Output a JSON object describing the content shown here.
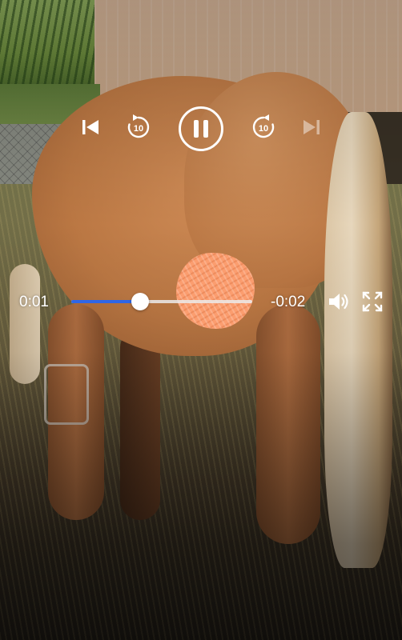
{
  "player": {
    "state": "playing",
    "time_elapsed": "0:01",
    "time_remaining": "-0:02",
    "progress_fraction": 0.38,
    "accent_color": "#2f66e6",
    "controls": {
      "previous": {
        "icon": "skip-previous-icon",
        "enabled": true
      },
      "rewind": {
        "icon": "rewind-10-icon",
        "seconds": "10",
        "enabled": true
      },
      "pause": {
        "icon": "pause-icon",
        "enabled": true
      },
      "forward": {
        "icon": "forward-10-icon",
        "seconds": "10",
        "enabled": true
      },
      "next": {
        "icon": "skip-next-icon",
        "enabled": false
      },
      "volume": {
        "icon": "volume-icon",
        "enabled": true
      },
      "fullscreen": {
        "icon": "fullscreen-icon",
        "enabled": true
      }
    }
  }
}
